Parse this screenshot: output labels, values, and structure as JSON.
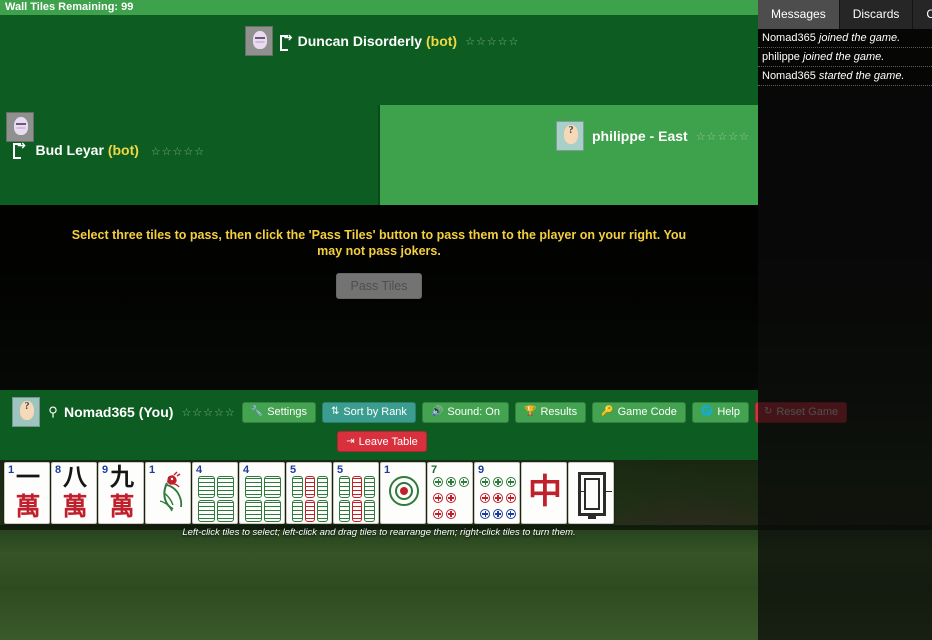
{
  "wall": {
    "label": "Wall Tiles Remaining: 99"
  },
  "seats": {
    "top": {
      "name": "Duncan Disorderly",
      "tag": "(bot)",
      "stars": "☆☆☆☆☆",
      "avatar": "bot-avatar"
    },
    "left": {
      "name": "Bud Leyar",
      "tag": "(bot)",
      "stars": "☆☆☆☆☆",
      "avatar": "bot-avatar"
    },
    "right": {
      "name": "philippe - East",
      "tag": "",
      "stars": "☆☆☆☆☆",
      "avatar": "human-avatar"
    },
    "bottom": {
      "name": "Nomad365 (You)",
      "tag": "",
      "stars": "☆☆☆☆☆",
      "avatar": "human-avatar"
    }
  },
  "instruction": {
    "text": "Select three tiles to pass, then click the 'Pass Tiles' button to pass them to the player on your right. You may not pass jokers.",
    "pass_button": "Pass Tiles"
  },
  "toolbar": {
    "settings": "Settings",
    "sort_by_rank": "Sort by Rank",
    "sound": "Sound: On",
    "results": "Results",
    "game_code": "Game Code",
    "help": "Help",
    "reset_game": "Reset Game",
    "leave_table": "Leave Table"
  },
  "rack": {
    "hint": "Left-click tiles to select; left-click and drag tiles to rearrange them; right-click tiles to turn them.",
    "tiles": [
      {
        "type": "character",
        "rank": "1",
        "glyph_top": "一",
        "glyph_bottom": "萬",
        "name": "1-crak"
      },
      {
        "type": "character",
        "rank": "8",
        "glyph_top": "八",
        "glyph_bottom": "萬",
        "name": "8-crak"
      },
      {
        "type": "character",
        "rank": "9",
        "glyph_top": "九",
        "glyph_bottom": "萬",
        "name": "9-crak"
      },
      {
        "type": "bamboo-bird",
        "rank": "1",
        "name": "1-bam"
      },
      {
        "type": "bamboo",
        "rank": "4",
        "name": "4-bam"
      },
      {
        "type": "bamboo",
        "rank": "4",
        "name": "4-bam"
      },
      {
        "type": "bamboo",
        "rank": "5",
        "name": "5-bam"
      },
      {
        "type": "bamboo",
        "rank": "5",
        "name": "5-bam"
      },
      {
        "type": "dot-big",
        "rank": "1",
        "name": "1-dot"
      },
      {
        "type": "dot",
        "rank": "7",
        "name": "7-dot"
      },
      {
        "type": "dot",
        "rank": "9",
        "name": "9-dot"
      },
      {
        "type": "dragon-red",
        "rank": "",
        "glyph": "中",
        "name": "red-dragon"
      },
      {
        "type": "dragon-white",
        "rank": "",
        "name": "white-dragon-soap"
      }
    ]
  },
  "chat": {
    "tabs": [
      {
        "label": "Messages",
        "active": true
      },
      {
        "label": "Discards",
        "active": false
      },
      {
        "label": "Car",
        "active": false
      }
    ],
    "messages": [
      {
        "who": "Nomad365",
        "act": " joined the game."
      },
      {
        "who": "philippe",
        "act": " joined the game."
      },
      {
        "who": "Nomad365",
        "act": " started the game."
      }
    ]
  },
  "colors": {
    "table_green": "#0d5c21",
    "active_green": "#3ea14b",
    "accent_yellow": "#f5cf3e",
    "danger_red": "#d9303e"
  }
}
